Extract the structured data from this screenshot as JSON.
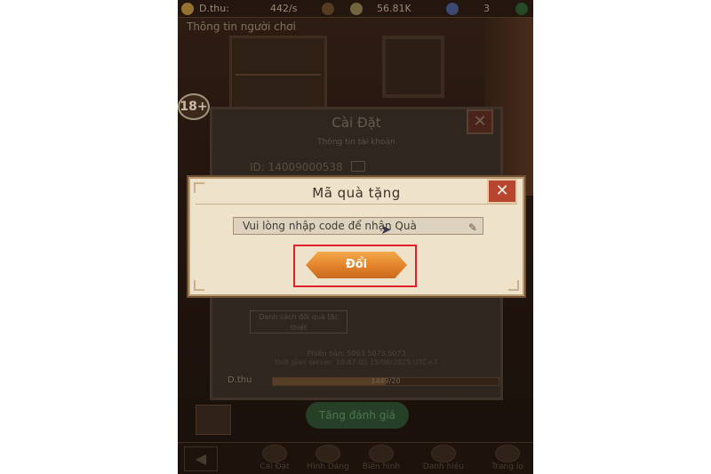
{
  "topbar": {
    "dthu_label": "D.thu:",
    "dthu_value": "442/s",
    "gems_value": "56.81K",
    "count_value": "3"
  },
  "player_info_title": "Thông tin người chơi",
  "age_rating": "18+",
  "settings_panel": {
    "title": "Cài Đặt",
    "subtitle": "Thông tin tài khoản",
    "account_id": "ID: 14009000538",
    "close_glyph": "✕",
    "policy_button": "Danh sách đối quà tặc thiết",
    "version": "Phiên bản: 5063.5073.5073",
    "server_time": "thời gian server: 10:47:05 15/06/2025 UTC+7"
  },
  "dthu_progress": {
    "label": "D.thu",
    "text": "1449/20",
    "fraction": 0.5
  },
  "rate_button": "Tăng đánh giá",
  "bottom_nav": [
    {
      "label": "Cài Đặt"
    },
    {
      "label": "Hình Dáng"
    },
    {
      "label": "Biển hình"
    },
    {
      "label": "Danh hiệu"
    },
    {
      "label": "Trang lọ"
    }
  ],
  "gift_dialog": {
    "title": "Mã quà tặng",
    "close_glyph": "✕",
    "input_placeholder": "Vui lòng nhập code để nhận Quà",
    "redeem_label": "Đổi"
  },
  "colors": {
    "dialog_bg": "#efe2ca",
    "redeem_button": "#e2822c",
    "close_button": "#b8452f",
    "highlight": "#e0202a"
  }
}
